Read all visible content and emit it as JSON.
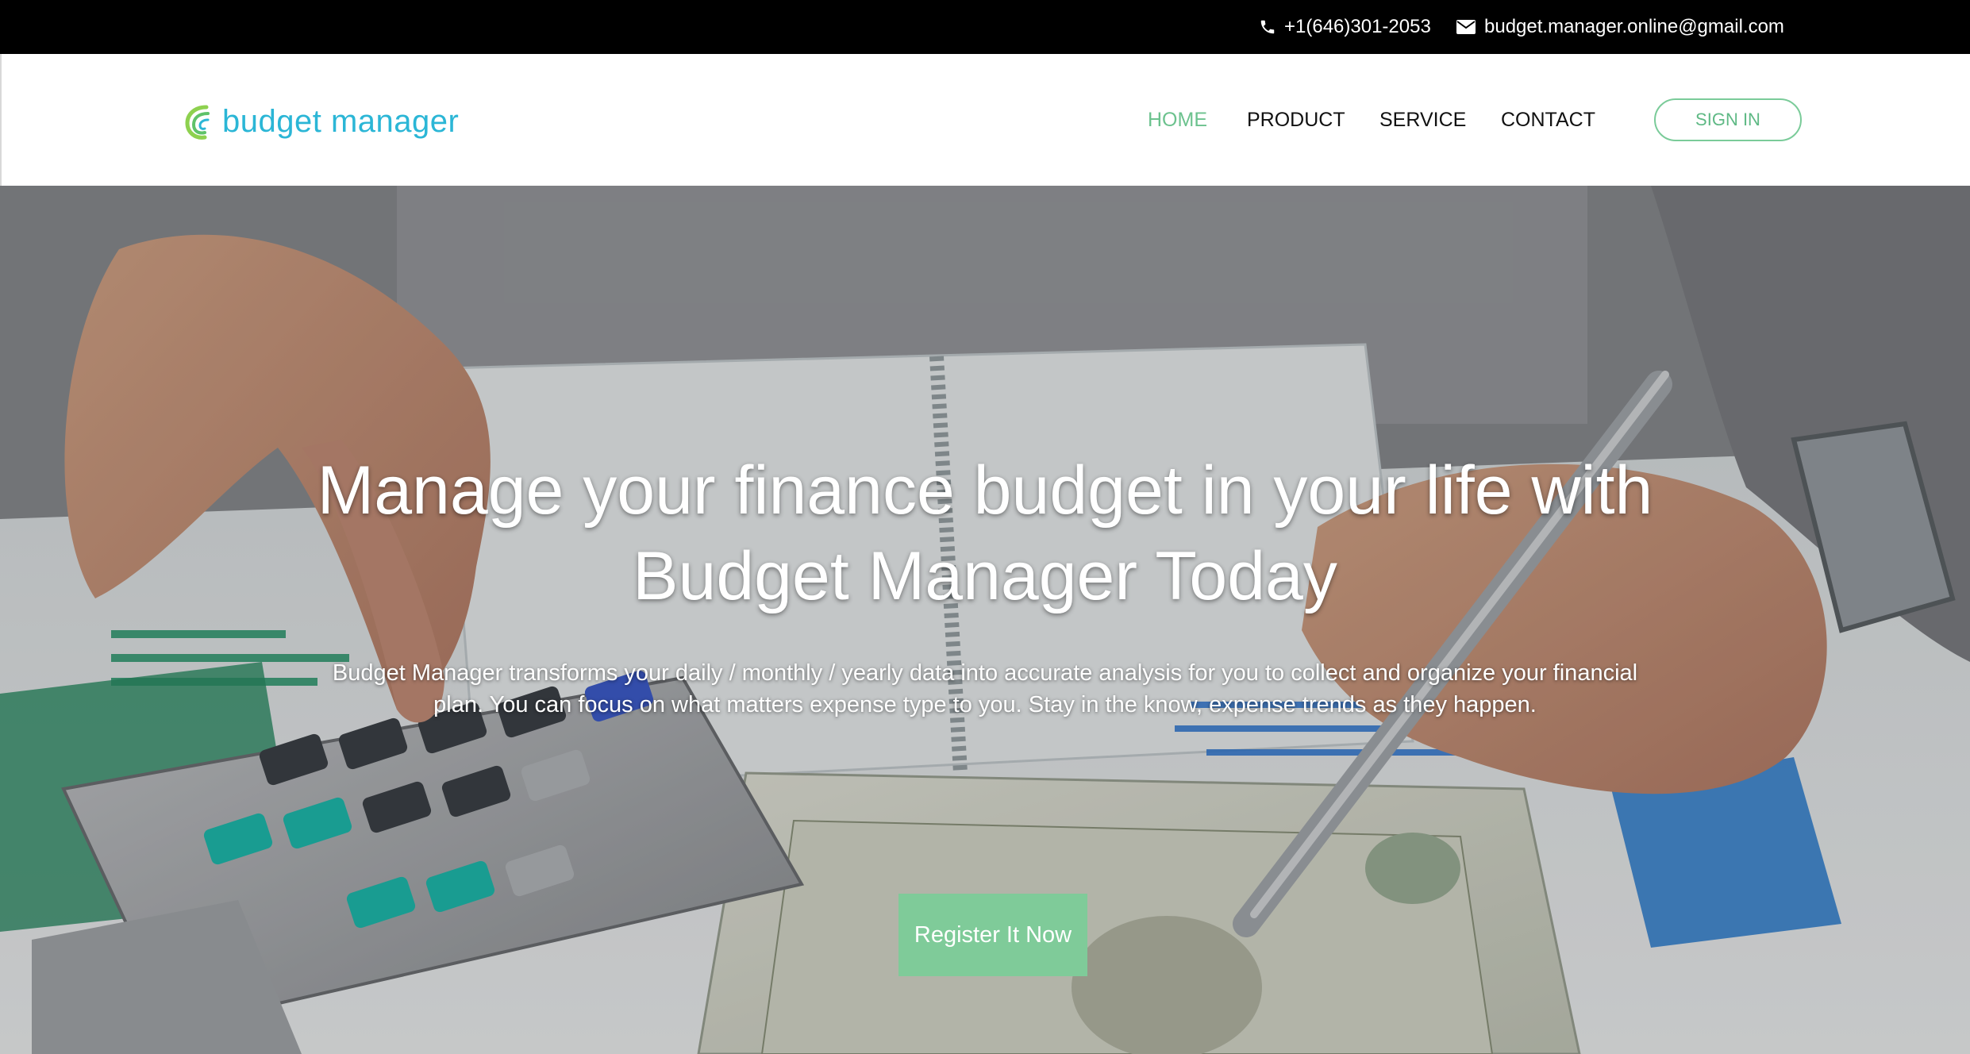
{
  "topbar": {
    "phone": "+1(646)301-2053",
    "email": "budget.manager.online@gmail.com"
  },
  "brand": {
    "name": "budget manager"
  },
  "nav": {
    "items": [
      {
        "label": "HOME",
        "active": true
      },
      {
        "label": "PRODUCT",
        "active": false
      },
      {
        "label": "SERVICE",
        "active": false
      },
      {
        "label": "CONTACT",
        "active": false
      }
    ],
    "signin_label": "SIGN IN"
  },
  "hero": {
    "title_line1": "Manage your finance budget in your life with",
    "title_line2": "Budget Manager Today",
    "subtitle_line1": "Budget Manager transforms your daily / monthly / yearly data into accurate analysis for you to collect and organize your financial",
    "subtitle_line2": "plan. You can focus on what matters expense type to you. Stay in the know, expense trends as they happen.",
    "cta_label": "Register It Now"
  },
  "colors": {
    "accent_green": "#7fcb99",
    "logo_blue": "#2bb6d6",
    "topbar_bg": "#000000"
  },
  "icons": {
    "phone": "phone-icon",
    "email": "envelope-icon",
    "logo": "logo-swirl-icon"
  }
}
